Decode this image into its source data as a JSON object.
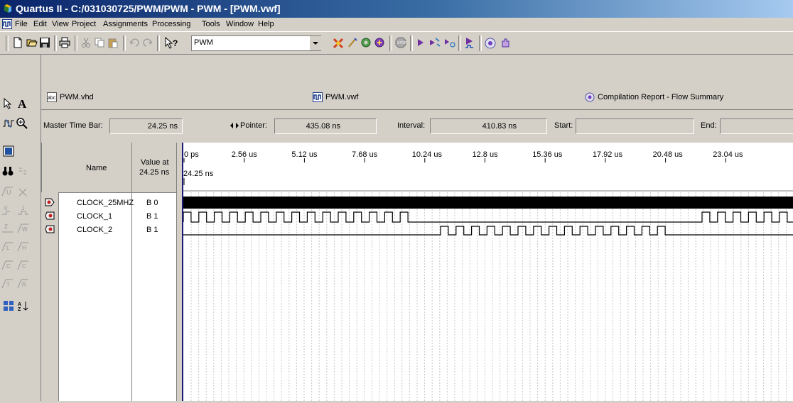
{
  "window": {
    "title": "Quartus II - C:/031030725/PWM/PWM - PWM - [PWM.vwf]"
  },
  "menu": [
    "File",
    "Edit",
    "View",
    "Project",
    "Assignments",
    "Processing",
    "Tools",
    "Window",
    "Help"
  ],
  "toolbar": {
    "combo_value": "PWM"
  },
  "tabs": {
    "vhd": "PWM.vhd",
    "vwf": "PWM.vwf",
    "report": "Compilation Report - Flow Summary"
  },
  "infobar": {
    "master_label": "Master Time Bar:",
    "master_value": "24.25 ns",
    "pointer_label": "Pointer:",
    "pointer_value": "435.08 ns",
    "interval_label": "Interval:",
    "interval_value": "410.83 ns",
    "start_label": "Start:",
    "start_value": "",
    "end_label": "End:",
    "end_value": ""
  },
  "table": {
    "name_header": "Name",
    "value_header_line1": "Value at",
    "value_header_line2": "24.25 ns",
    "rows": [
      {
        "name": "CLOCK_25MHZ",
        "value": "B 0"
      },
      {
        "name": "CLOCK_1",
        "value": "B 1"
      },
      {
        "name": "CLOCK_2",
        "value": "B 1"
      }
    ]
  },
  "timeline": {
    "ticks": [
      "0 ps",
      "2.56 us",
      "5.12 us",
      "7.68 us",
      "10.24 us",
      "12.8 us",
      "15.36 us",
      "17.92 us",
      "20.48 us",
      "23.04 us"
    ],
    "cursor_label": "24.25 ns"
  },
  "colors": {
    "title_start": "#0a246a",
    "title_end": "#a6caf0",
    "cursor": "#1a1a7a"
  }
}
